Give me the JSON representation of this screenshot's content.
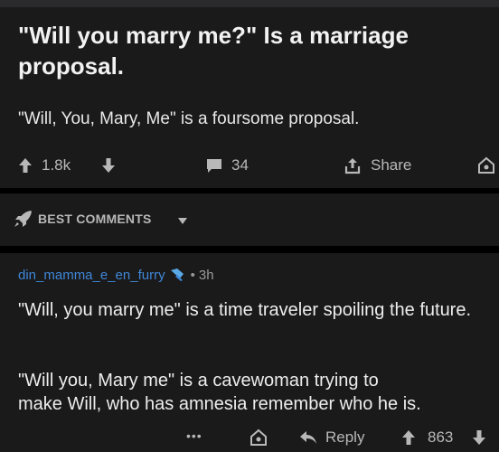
{
  "post": {
    "title": "\"Will you marry me?\" Is a marriage proposal.",
    "body": "\"Will, You, Mary, Me\" is a foursome proposal.",
    "score": "1.8k",
    "comment_count": "34",
    "share_label": "Share",
    "icons": [
      "upvote-icon",
      "downvote-icon",
      "comment-bubble-icon",
      "share-icon",
      "award-icon"
    ]
  },
  "sort": {
    "label": "BEST COMMENTS",
    "icons": [
      "rocket-icon",
      "caret-down-icon"
    ]
  },
  "comment": {
    "username": "din_mamma_e_en_furry",
    "separator": "•",
    "timestamp": "3h",
    "paragraphs": [
      "\"Will, you marry me\" is a time traveler spoiling the future.",
      "\"Will you, Mary me\" is a cavewoman trying to",
      "make Will, who has amnesia remember who he is."
    ],
    "more_label": "•••",
    "reply_label": "Reply",
    "score": "863",
    "icons": [
      "flair-icon",
      "more-icon",
      "award-icon",
      "reply-icon",
      "upvote-icon",
      "downvote-icon"
    ]
  },
  "colors": {
    "background": "#000000",
    "card": "#1a1a1b",
    "text": "#ededed",
    "muted": "#b8b8b8",
    "username": "#3f86d6"
  }
}
